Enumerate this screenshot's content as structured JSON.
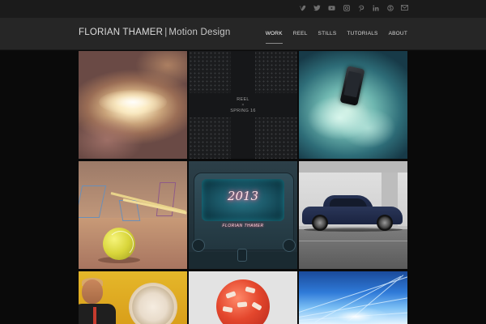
{
  "header": {
    "brand_name": "FLORIAN THAMER",
    "brand_separator": "|",
    "brand_tagline": "Motion Design"
  },
  "social": {
    "icons": [
      "vimeo-icon",
      "twitter-icon",
      "youtube-icon",
      "instagram-icon",
      "pinterest-icon",
      "linkedin-icon",
      "skype-icon",
      "email-icon"
    ]
  },
  "nav": {
    "items": [
      {
        "label": "WORK",
        "active": true
      },
      {
        "label": "REEL",
        "active": false
      },
      {
        "label": "STILLS",
        "active": false
      },
      {
        "label": "TUTORIALS",
        "active": false
      },
      {
        "label": "ABOUT",
        "active": false
      }
    ]
  },
  "tiles": {
    "reel": {
      "line1": "REEL",
      "line2": "×",
      "line3": "SPRING 16"
    },
    "neon": {
      "title": "2013",
      "subtitle": "FLORIAN THAMER"
    }
  },
  "colors": {
    "background": "#0a0a0a",
    "header": "#262626",
    "topbar": "#1b1b1b",
    "nav_text": "#d6d6d6"
  }
}
